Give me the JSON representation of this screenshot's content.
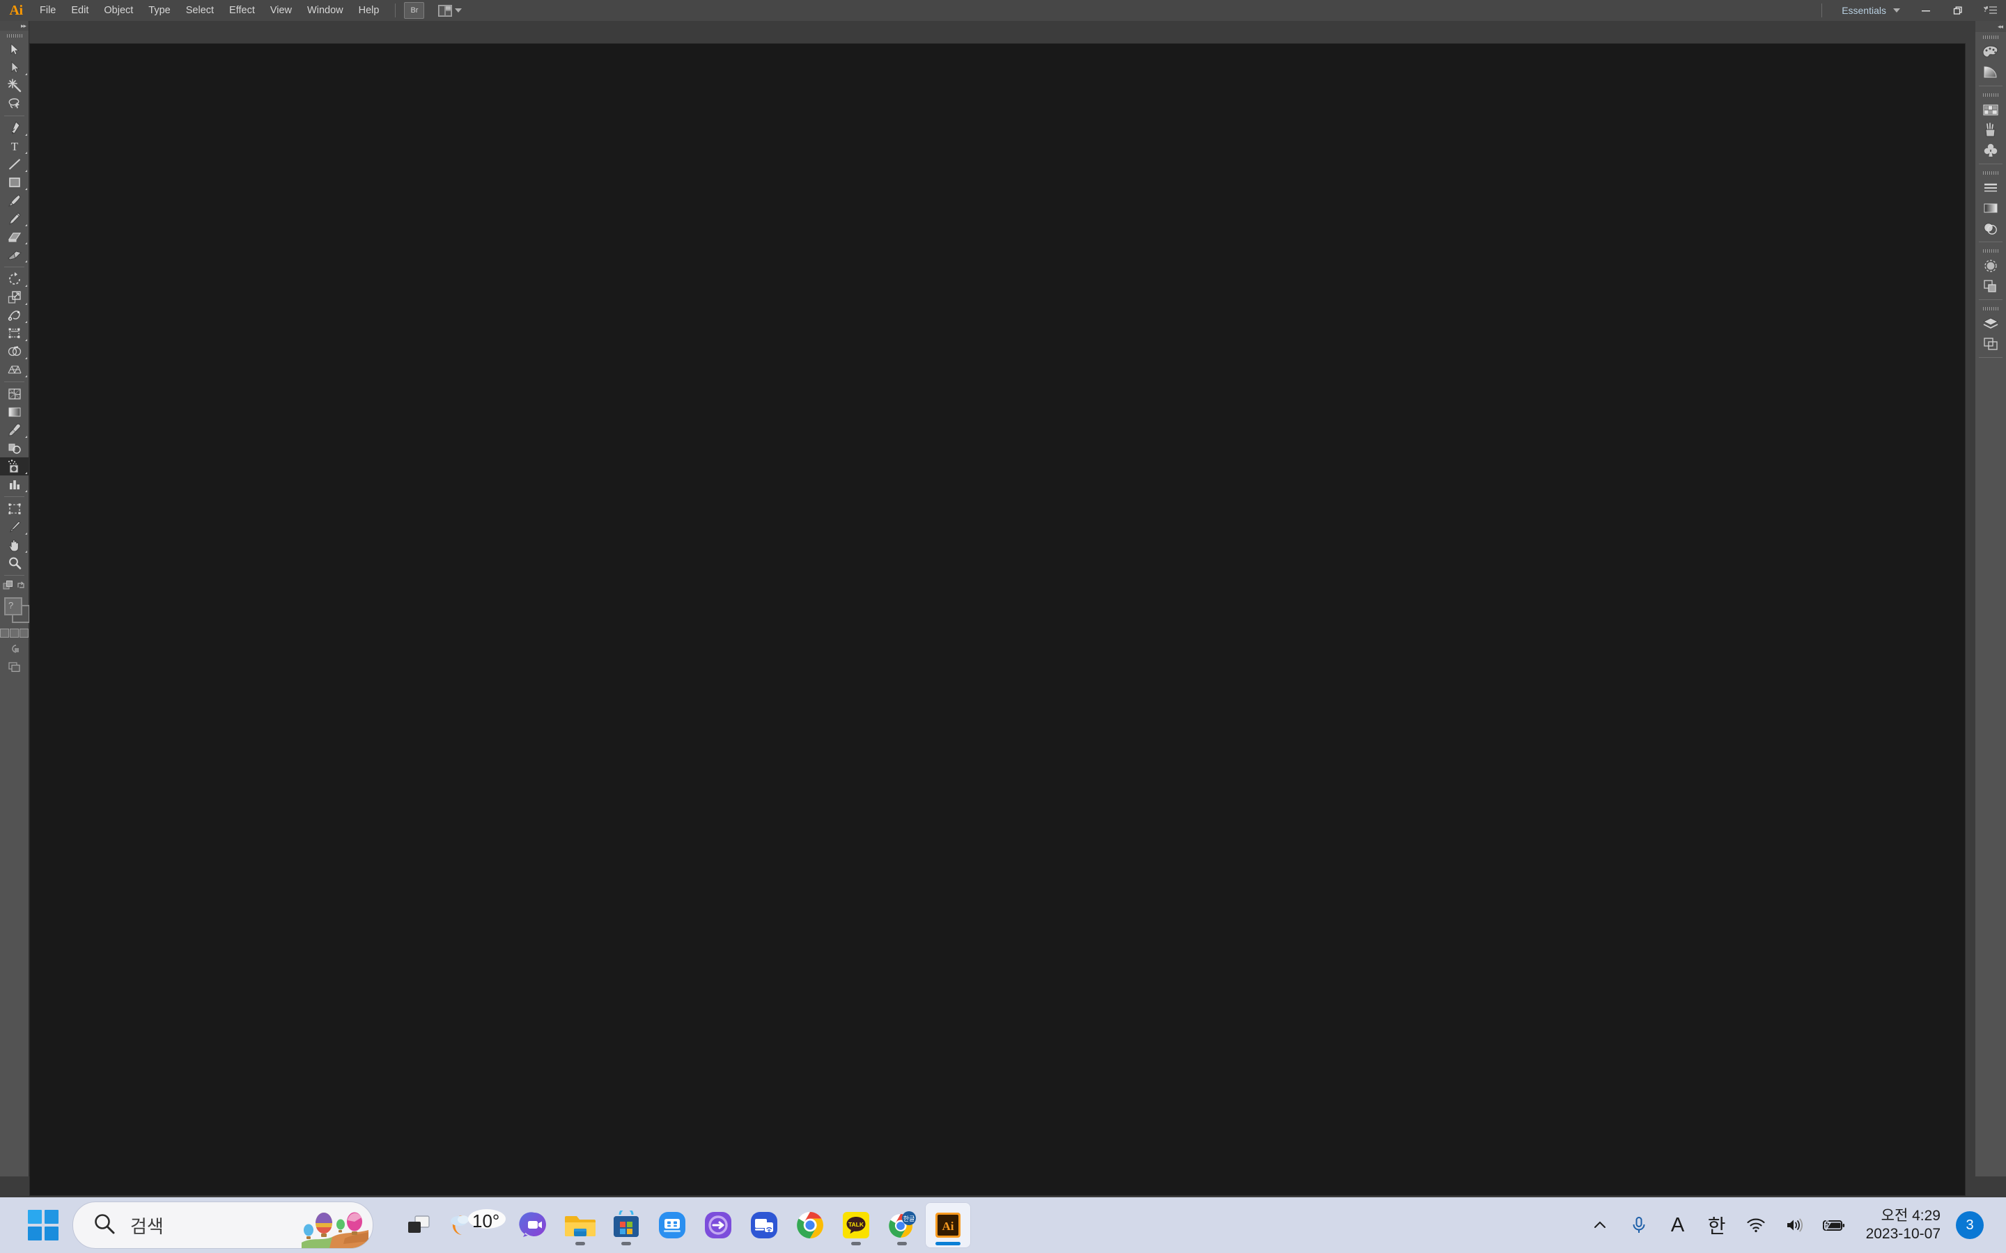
{
  "app": {
    "name": "Adobe Illustrator",
    "logo_text": "Ai",
    "logo_color": "#ff9a00",
    "canvas_color": "#191919",
    "chrome_color": "#474747"
  },
  "menubar": {
    "items": [
      {
        "label": "File"
      },
      {
        "label": "Edit"
      },
      {
        "label": "Object"
      },
      {
        "label": "Type"
      },
      {
        "label": "Select"
      },
      {
        "label": "Effect"
      },
      {
        "label": "View"
      },
      {
        "label": "Window"
      },
      {
        "label": "Help"
      }
    ],
    "bridge_label": "Br",
    "arrange_documents_tooltip": "Arrange Documents",
    "workspace": "Essentials",
    "window_controls": {
      "minimize": "—",
      "restore": "❐",
      "close": "✕"
    }
  },
  "toolbar": {
    "collapse_label": "▸▸",
    "groups": [
      {
        "tools": [
          {
            "name": "selection-tool",
            "label": "Selection Tool",
            "has_flyout": false
          },
          {
            "name": "direct-selection-tool",
            "label": "Direct Selection Tool",
            "has_flyout": true
          },
          {
            "name": "magic-wand-tool",
            "label": "Magic Wand Tool",
            "has_flyout": false
          },
          {
            "name": "lasso-tool",
            "label": "Lasso Tool",
            "has_flyout": false
          }
        ]
      },
      {
        "tools": [
          {
            "name": "pen-tool",
            "label": "Pen Tool",
            "has_flyout": true
          },
          {
            "name": "type-tool",
            "label": "Type Tool",
            "has_flyout": true
          },
          {
            "name": "line-segment-tool",
            "label": "Line Segment Tool",
            "has_flyout": true
          },
          {
            "name": "rectangle-tool",
            "label": "Rectangle Tool",
            "has_flyout": true
          },
          {
            "name": "paintbrush-tool",
            "label": "Paintbrush Tool",
            "has_flyout": true
          },
          {
            "name": "pencil-tool",
            "label": "Pencil Tool",
            "has_flyout": true
          },
          {
            "name": "shaper-tool",
            "label": "Shaper Tool",
            "has_flyout": true
          },
          {
            "name": "eraser-tool",
            "label": "Eraser Tool",
            "has_flyout": true
          }
        ]
      },
      {
        "tools": [
          {
            "name": "rotate-tool",
            "label": "Rotate Tool",
            "has_flyout": true
          },
          {
            "name": "scale-tool",
            "label": "Scale Tool",
            "has_flyout": true
          },
          {
            "name": "width-tool",
            "label": "Width Tool",
            "has_flyout": true
          },
          {
            "name": "free-transform-tool",
            "label": "Free Transform Tool",
            "has_flyout": true
          },
          {
            "name": "shape-builder-tool",
            "label": "Shape Builder Tool",
            "has_flyout": true
          },
          {
            "name": "perspective-grid-tool",
            "label": "Perspective Grid Tool",
            "has_flyout": true
          }
        ]
      },
      {
        "tools": [
          {
            "name": "mesh-tool",
            "label": "Mesh Tool",
            "has_flyout": false
          },
          {
            "name": "gradient-tool",
            "label": "Gradient Tool",
            "has_flyout": false
          },
          {
            "name": "eyedropper-tool",
            "label": "Eyedropper Tool",
            "has_flyout": true
          },
          {
            "name": "blend-tool",
            "label": "Blend Tool",
            "has_flyout": false
          },
          {
            "name": "symbol-sprayer-tool",
            "label": "Symbol Sprayer Tool",
            "has_flyout": true,
            "selected": true
          },
          {
            "name": "column-graph-tool",
            "label": "Column Graph Tool",
            "has_flyout": true
          }
        ]
      },
      {
        "tools": [
          {
            "name": "artboard-tool",
            "label": "Artboard Tool",
            "has_flyout": false
          },
          {
            "name": "slice-tool",
            "label": "Slice Tool",
            "has_flyout": true
          },
          {
            "name": "hand-tool",
            "label": "Hand Tool",
            "has_flyout": true
          },
          {
            "name": "zoom-tool",
            "label": "Zoom Tool",
            "has_flyout": false
          }
        ]
      }
    ],
    "bottom": {
      "fill_label": "Fill",
      "stroke_label": "Stroke",
      "swap_label": "Swap Fill and Stroke",
      "question_mark": "?",
      "color_modes": [
        "color",
        "gradient",
        "none"
      ],
      "drawing_mode": "Draw Normal",
      "screen_mode": "Change Screen Mode"
    }
  },
  "right_dock": {
    "menu_icon": "panel-menu-icon",
    "collapse_label": "◂◂",
    "groups": [
      {
        "icons": [
          {
            "name": "color-panel-icon",
            "label": "Color"
          },
          {
            "name": "color-guide-panel-icon",
            "label": "Color Guide"
          }
        ]
      },
      {
        "icons": [
          {
            "name": "swatches-panel-icon",
            "label": "Swatches"
          },
          {
            "name": "brushes-panel-icon",
            "label": "Brushes"
          },
          {
            "name": "symbols-panel-icon",
            "label": "Symbols"
          }
        ]
      },
      {
        "icons": [
          {
            "name": "stroke-panel-icon",
            "label": "Stroke"
          },
          {
            "name": "gradient-panel-icon",
            "label": "Gradient"
          },
          {
            "name": "transparency-panel-icon",
            "label": "Transparency"
          }
        ]
      },
      {
        "icons": [
          {
            "name": "appearance-panel-icon",
            "label": "Appearance"
          },
          {
            "name": "graphic-styles-panel-icon",
            "label": "Graphic Styles"
          }
        ]
      },
      {
        "icons": [
          {
            "name": "layers-panel-icon",
            "label": "Layers"
          },
          {
            "name": "artboards-panel-icon",
            "label": "Artboards"
          }
        ]
      }
    ]
  },
  "taskbar": {
    "start_label": "Start",
    "search": {
      "placeholder": "검색",
      "icon": "search-icon",
      "decoration": "hot-air-balloons-illustration"
    },
    "task_view_label": "Task View",
    "items": [
      {
        "name": "weather-widget",
        "label": "10°",
        "temp": "10°",
        "running": false
      },
      {
        "name": "taskbar-item-chat",
        "label": "Chat",
        "running": false
      },
      {
        "name": "taskbar-item-file-explorer",
        "label": "File Explorer",
        "running": true
      },
      {
        "name": "taskbar-item-microsoft-store",
        "label": "Microsoft Store",
        "running": true
      },
      {
        "name": "taskbar-item-samsung-quick-share",
        "label": "Quick Share",
        "running": false
      },
      {
        "name": "taskbar-item-samsung-smart-switch",
        "label": "Smart Switch",
        "running": false
      },
      {
        "name": "taskbar-item-samsung-multi-control",
        "label": "Multi Control",
        "running": false
      },
      {
        "name": "taskbar-item-google-chrome",
        "label": "Google Chrome",
        "running": false
      },
      {
        "name": "taskbar-item-kakaotalk",
        "label": "KakaoTalk",
        "badge": "TALK",
        "running": true
      },
      {
        "name": "taskbar-item-chrome-korean-app",
        "label": "Chrome App",
        "badge": "한글",
        "running": true
      },
      {
        "name": "taskbar-item-adobe-illustrator",
        "label": "Adobe Illustrator",
        "badge": "Ai",
        "running": true,
        "active": true
      }
    ],
    "tray": {
      "show_hidden_label": "^",
      "icons": [
        {
          "name": "microphone-icon",
          "label": "Microphone"
        },
        {
          "name": "ime-alpha-icon",
          "label": "A"
        },
        {
          "name": "ime-korean-icon",
          "label": "한"
        },
        {
          "name": "wifi-icon",
          "label": "Network"
        },
        {
          "name": "volume-icon",
          "label": "Volume"
        },
        {
          "name": "battery-charging-icon",
          "label": "Battery charging"
        }
      ],
      "ime_alpha": "A",
      "ime_korean": "한",
      "clock_time": "오전 4:29",
      "clock_date": "2023-10-07",
      "notification_count": "3"
    }
  }
}
